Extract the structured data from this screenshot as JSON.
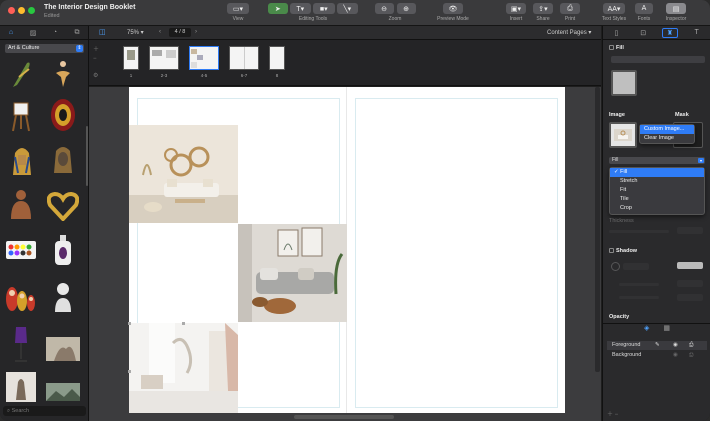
{
  "window": {
    "title": "The Interior Design Booklet",
    "subtitle": "Edited"
  },
  "toolbar": {
    "view": "View",
    "editing_tools": "Editing Tools",
    "zoom": "Zoom",
    "preview_mode": "Preview Mode",
    "insert": "Insert",
    "share": "Share",
    "print": "Print",
    "text_styles": "Text Styles",
    "fonts": "Fonts",
    "inspector": "Inspector"
  },
  "left_panel": {
    "category": "Art & Culture",
    "search_placeholder": "Search",
    "items": [
      "feather-icon",
      "ballerina-icon",
      "easel-icon",
      "tomato-can-icon",
      "sphinx-icon",
      "pharaoh-mask-icon",
      "buddha-icon",
      "heart-frame-icon",
      "paint-palette-icon",
      "perfume-bottle-icon",
      "nesting-dolls-icon",
      "bust-icon",
      "mannequin-icon",
      "sculpture-icon",
      "statue-icon",
      "painting-icon"
    ]
  },
  "navbar": {
    "zoom": "75%",
    "page_indicator": "4 / 8",
    "section": "Content Pages"
  },
  "thumbnails": [
    {
      "label": "1"
    },
    {
      "label": "2-3"
    },
    {
      "label": "4-5"
    },
    {
      "label": "6-7"
    },
    {
      "label": "8"
    }
  ],
  "inspector": {
    "fill_label": "Fill",
    "image_label": "Image",
    "mask_label": "Mask",
    "mask_menu": [
      "Custom Image...",
      "Clear Image"
    ],
    "fill_mode": "Fill",
    "fill_modes": [
      "Fill",
      "Stretch",
      "Fit",
      "Tile",
      "Crop"
    ],
    "fill_selected": "Fill",
    "thickness_label": "Thickness",
    "shadow_label": "Shadow",
    "opacity_label": "Opacity",
    "layers": [
      "Foreground",
      "Background"
    ]
  },
  "colors": {
    "accent": "#2f7cf6",
    "toolbar_bg": "#3a3a3c",
    "panel_bg": "#262628",
    "canvas_bg": "#3c3c3e"
  }
}
